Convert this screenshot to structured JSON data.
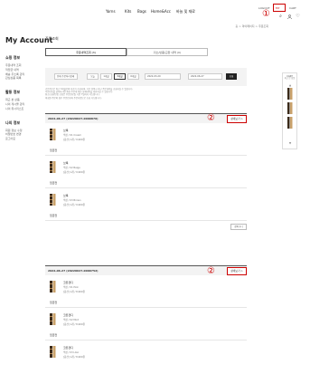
{
  "nav": {
    "items": [
      "Yarns",
      "Kits",
      "Bags",
      "Home&Acc",
      "바늘 및 재료"
    ],
    "util": {
      "logout": "LOGOUT",
      "mypage": "MY",
      "cart": "CART"
    }
  },
  "annotations": {
    "one": "①",
    "two": "②"
  },
  "breadcrumb": "홈 > 마이페이지 > 주문조회",
  "sidebar": {
    "title": "My Account",
    "groups": [
      {
        "title": "쇼핑 정보",
        "links": [
          "주문내역 조회",
          "적립금 내역",
          "배송 주소록 관리",
          "관심상품 목록"
        ]
      },
      {
        "title": "활동 정보",
        "links": [
          "최근 본 상품",
          "나의 게시물 관리",
          "나의 위시리스트"
        ]
      },
      {
        "title": "나의 정보",
        "links": [
          "회원 정보 수정",
          "비밀번호 변경",
          "로그아웃"
        ]
      }
    ]
  },
  "main": {
    "title": "주문조회",
    "tabs": [
      "주문내역조회 (3)",
      "취소/반품/교환 내역 (0)"
    ],
    "filter": {
      "status": "전체 주문처리상태",
      "periods": [
        "오늘",
        "1개월",
        "3개월",
        "6개월"
      ],
      "date_from": "2022-03-29",
      "date_sep": "~",
      "date_to": "2022-06-27",
      "search": "조회"
    },
    "notes": [
      "기본적으로 최근 3개월간의 자료가 조회되며, 기간 검색시 지난 주문내역을 조회하실 수 있습니다.",
      "주문번호를 클릭하시면 해당 주문에 대한 상세내역을 확인하실 수 있습니다.",
      "취소/교환/반품 신청은 주문완료일 기준 7일까지 가능합니다.",
      "비회원 주문의 경우 주문번호와 주문자명으로 조회 가능합니다."
    ]
  },
  "orders": [
    {
      "order_no": "2022-06-27 (20220627-0000876)",
      "detail": "상세보기 >",
      "items": [
        {
          "name": "브룩",
          "option": "색상 / 01 Cream",
          "price": "[옵션] 1개 / 9,900원",
          "status": "입금전"
        },
        {
          "name": "브룩",
          "option": "색상 / 02 Beige",
          "price": "[옵션] 1개 / 9,900원",
          "status": "입금전"
        },
        {
          "name": "브룩",
          "option": "색상 / 03 Brown",
          "price": "[옵션] 1개 / 9,900원",
          "status": "입금전"
        }
      ],
      "cart": "장바구니"
    },
    {
      "order_no": "2022-06-27 (20220627-0000752)",
      "detail": "상세보기 >",
      "items": [
        {
          "name": "코튼캔디",
          "option": "색상 / 01 Pink",
          "price": "[옵션] 1개 / 8,900원",
          "status": "입금전"
        },
        {
          "name": "코튼캔디",
          "option": "색상 / 02 Mint",
          "price": "[옵션] 1개 / 8,900원",
          "status": "입금전"
        },
        {
          "name": "코튼캔디",
          "option": "색상 / 03 Lilac",
          "price": "[옵션] 1개 / 8,900원",
          "status": ""
        }
      ]
    }
  ],
  "recent": {
    "title": "CART",
    "subtitle": "최근 본 상품",
    "up": "▲",
    "down": "▼"
  },
  "colors": {
    "accent": "#cc0000",
    "dark": "#222222",
    "panel": "#f3f3f3"
  }
}
